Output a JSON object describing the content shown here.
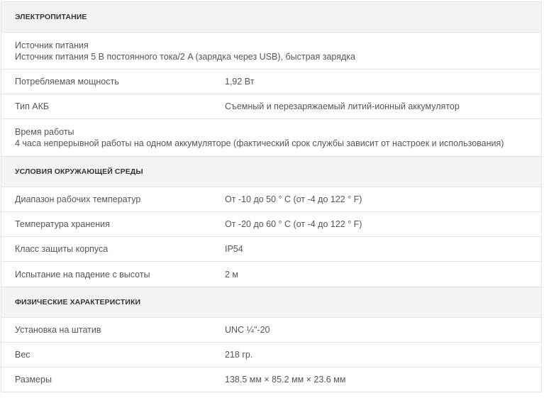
{
  "sections": [
    {
      "title": "ЭЛЕКТРОПИТАНИЕ",
      "rows": [
        {
          "label": "Источник питания",
          "value": "Источник питания 5 В постоянного тока/2 A (зарядка через USB), быстрая зарядка"
        },
        {
          "label": "Потребляемая мощность",
          "value": "1,92 Вт"
        },
        {
          "label": "Тип АКБ",
          "value": "Съемный и перезаряжаемый литий-ионный аккумулятор"
        },
        {
          "label": "Время работы",
          "value": "4 часа непрерывной работы на одном аккумуляторе (фактический срок службы зависит от настроек и использования)"
        }
      ]
    },
    {
      "title": "УСЛОВИЯ ОКРУЖАЮЩЕЙ СРЕДЫ",
      "rows": [
        {
          "label": "Диапазон рабочих температур",
          "value": "От -10 до 50 ° C (от -4 до 122 ° F)"
        },
        {
          "label": "Температура хранения",
          "value": "От -20 до 60 ° C (от -4 до 122 ° F)"
        },
        {
          "label": "Класс защиты корпуса",
          "value": "IP54"
        },
        {
          "label": "Испытание на падение с высоты",
          "value": "2 м"
        }
      ]
    },
    {
      "title": "ФИЗИЧЕСКИЕ ХАРАКТЕРИСТИКИ",
      "rows": [
        {
          "label": "Установка на штатив",
          "value": "UNC ¼\"-20"
        },
        {
          "label": "Вес",
          "value": "218 гр."
        },
        {
          "label": "Размеры",
          "value": "138.5 мм × 85.2 мм × 23.6 мм"
        }
      ]
    }
  ]
}
